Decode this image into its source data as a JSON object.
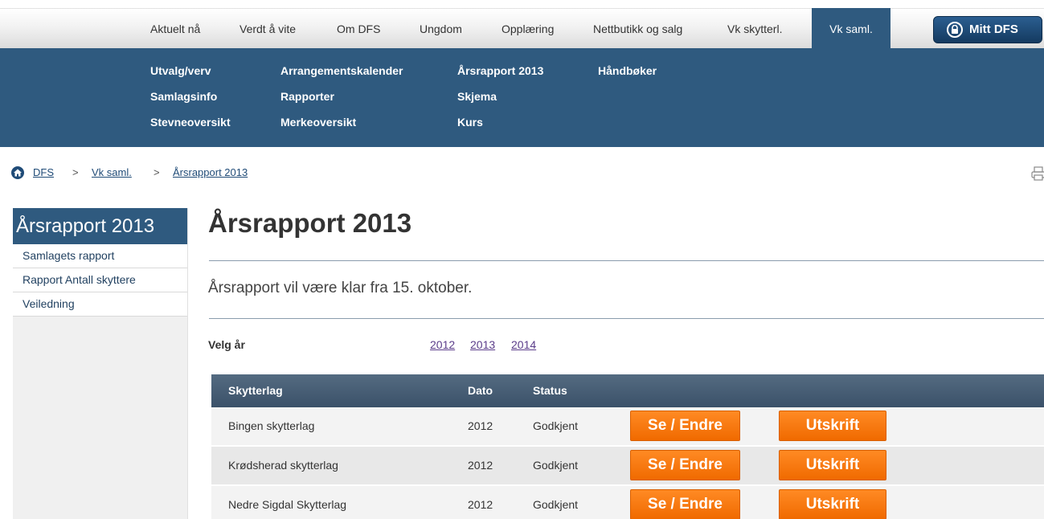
{
  "topnav": {
    "items": [
      "Aktuelt nå",
      "Verdt å vite",
      "Om DFS",
      "Ungdom",
      "Opplæring",
      "Nettbutikk og salg",
      "Vk skytterl.",
      "Vk saml."
    ],
    "active": "Vk saml.",
    "mitt_dfs": "Mitt DFS"
  },
  "submenu": {
    "col1": [
      "Utvalg/verv",
      "Samlagsinfo",
      "Stevneoversikt"
    ],
    "col2": [
      "Arrangementskalender",
      "Rapporter",
      "Merkeoversikt"
    ],
    "col3": [
      "Årsrapport 2013",
      "Skjema",
      "Kurs"
    ],
    "col4": [
      "Håndbøker"
    ]
  },
  "breadcrumb": {
    "items": [
      "DFS",
      "Vk saml.",
      "Årsrapport 2013"
    ],
    "separator": ">"
  },
  "sidebar": {
    "title": "Årsrapport 2013",
    "items": [
      "Samlagets rapport",
      "Rapport Antall skyttere",
      "Veiledning"
    ]
  },
  "main": {
    "title": "Årsrapport 2013",
    "notice": "Årsrapport vil være klar fra 15. oktober.",
    "year_label": "Velg år",
    "years": [
      "2012",
      "2013",
      "2014"
    ]
  },
  "table": {
    "headers": [
      "Skytterlag",
      "Dato",
      "Status"
    ],
    "rows": [
      {
        "name": "Bingen skytterlag",
        "date": "2012",
        "status": "Godkjent"
      },
      {
        "name": "Krødsherad skytterlag",
        "date": "2012",
        "status": "Godkjent"
      },
      {
        "name": "Nedre Sigdal Skytterlag",
        "date": "2012",
        "status": "Godkjent"
      }
    ],
    "edit_label": "Se / Endre",
    "print_label": "Utskrift"
  },
  "colors": {
    "brand_blue": "#2f5a7f",
    "button_orange": "#f27a10"
  }
}
